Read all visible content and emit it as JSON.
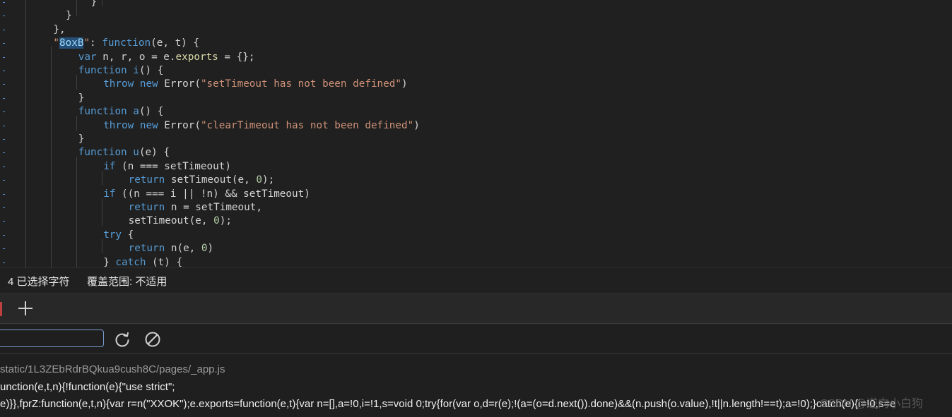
{
  "editor": {
    "lines": [
      {
        "indent": 5,
        "html": "<span>}</span>"
      },
      {
        "indent": 3,
        "html": "<span>}</span>"
      },
      {
        "indent": 2,
        "html": "<span>},</span>"
      },
      {
        "indent": 2,
        "html": "<span class=\"str\">\"<span class=\"sel\">8oxB</span>\"</span><span>: </span><span class=\"kw\">function</span><span>(e, t) {</span>"
      },
      {
        "indent": 4,
        "html": "<span class=\"kw\">var</span><span> n, r, o = e.</span><span class=\"prop\">exports</span><span> = {};</span>"
      },
      {
        "indent": 4,
        "html": "<span class=\"kw\">function</span><span> </span><span class=\"kw\">i</span><span>() {</span>"
      },
      {
        "indent": 6,
        "html": "<span class=\"kw\">throw</span><span> </span><span class=\"kw\">new</span><span> Error(</span><span class=\"str\">\"setTimeout has not been defined\"</span><span>)</span>"
      },
      {
        "indent": 4,
        "html": "<span>}</span>"
      },
      {
        "indent": 4,
        "html": "<span class=\"kw\">function</span><span> </span><span class=\"kw\">a</span><span>() {</span>"
      },
      {
        "indent": 6,
        "html": "<span class=\"kw\">throw</span><span> </span><span class=\"kw\">new</span><span> Error(</span><span class=\"str\">\"clearTimeout has not been defined\"</span><span>)</span>"
      },
      {
        "indent": 4,
        "html": "<span>}</span>"
      },
      {
        "indent": 4,
        "html": "<span class=\"kw\">function</span><span> </span><span class=\"kw\">u</span><span>(e) {</span>"
      },
      {
        "indent": 6,
        "html": "<span class=\"kw\">if</span><span> (n === setTimeout)</span>"
      },
      {
        "indent": 8,
        "html": "<span class=\"kw\">return</span><span> setTimeout(e, </span><span class=\"num\">0</span><span>);</span>"
      },
      {
        "indent": 6,
        "html": "<span class=\"kw\">if</span><span> ((n === i || !n) &amp;&amp; setTimeout)</span>"
      },
      {
        "indent": 8,
        "html": "<span class=\"kw\">return</span><span> n = setTimeout,</span>"
      },
      {
        "indent": 8,
        "html": "<span>setTimeout(e, </span><span class=\"num\">0</span><span>);</span>"
      },
      {
        "indent": 6,
        "html": "<span class=\"kw\">try</span><span> {</span>"
      },
      {
        "indent": 8,
        "html": "<span class=\"kw\">return</span><span> n(e, </span><span class=\"num\">0</span><span>)</span>"
      },
      {
        "indent": 6,
        "html": "<span>} </span><span class=\"kw\">catch</span><span> (t) {</span>"
      }
    ],
    "gutter_marker": "-"
  },
  "statusbar": {
    "selection": "4 已选择字符",
    "coverage": "覆盖范围: 不适用"
  },
  "console": {
    "filter_placeholder": "",
    "source": "static/1L3ZEbRdrBQkua9cush8C/pages/_app.js",
    "line1": "unction(e,t,n){!function(e){\"use strict\";",
    "line2": "e)}},fprZ:function(e,t,n){var r=n(\"XXOK\");e.exports=function(e,t){var n=[],a=!0,i=!1,s=void 0;try{for(var o,d=r(e);!(a=(o=d.next()).done)&&(n.push(o.value),!t||n.length!==t);a=!0);}catch(e){i=!0,s=e"
  },
  "watermark": "CSDN @逆向小白狗",
  "colors": {
    "keyword": "#569cd6",
    "string": "#ce9178",
    "number": "#b5cea8",
    "property": "#dcdcaa",
    "selection": "#264f78"
  },
  "icons": [
    "add-tab-icon",
    "refresh-icon",
    "clear-console-icon"
  ]
}
